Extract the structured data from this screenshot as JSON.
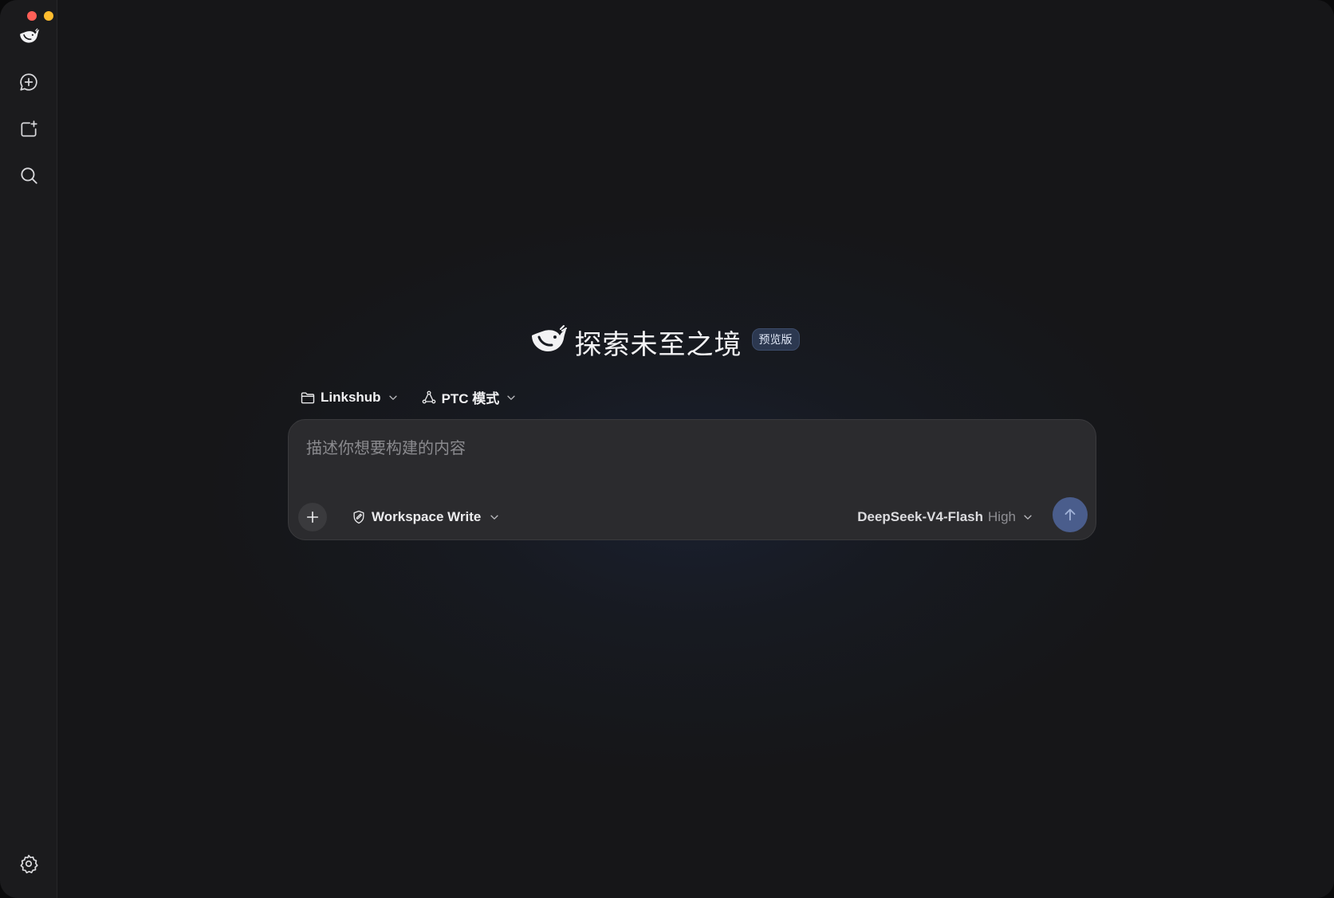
{
  "window": {
    "traffic_lights": [
      "close",
      "minimize",
      "maximize"
    ]
  },
  "sidebar": {
    "items": [
      {
        "icon": "whale-logo-icon"
      },
      {
        "icon": "new-chat-icon"
      },
      {
        "icon": "new-project-icon"
      },
      {
        "icon": "search-icon"
      }
    ],
    "footer_icon": "settings-gear-icon"
  },
  "hero": {
    "title": "探索未至之境",
    "badge": "预览版"
  },
  "selectors": {
    "project": "Linkshub",
    "mode": "PTC 模式"
  },
  "composer": {
    "placeholder": "描述你想要构建的内容",
    "value": "",
    "permission": "Workspace Write",
    "model_name": "DeepSeek-V4-Flash",
    "model_level": "High"
  },
  "colors": {
    "background": "#161618",
    "sidebar": "#1b1b1d",
    "composer": "#2b2b2e",
    "accent": "#4a5d8c",
    "badge_bg": "#2c3850"
  }
}
